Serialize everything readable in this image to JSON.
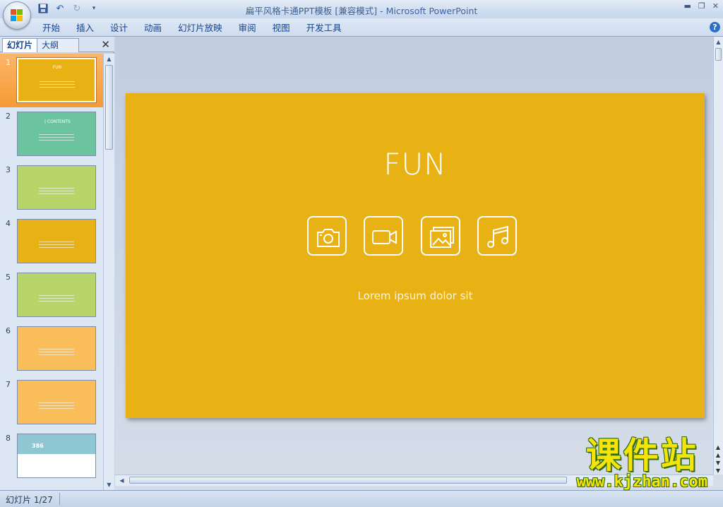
{
  "window": {
    "title_doc": "扁平风格卡通PPT模板 [兼容模式]",
    "title_sep": " - ",
    "title_app": "Microsoft PowerPoint"
  },
  "ribbon": {
    "tabs": [
      "开始",
      "插入",
      "设计",
      "动画",
      "幻灯片放映",
      "审阅",
      "视图",
      "开发工具"
    ],
    "help_label": "?"
  },
  "left_pane": {
    "tabs": [
      "幻灯片",
      "大纲"
    ],
    "close_label": "✕",
    "thumbnails": [
      {
        "num": "1",
        "bg": "#e8b215",
        "title": "FUN",
        "selected": true
      },
      {
        "num": "2",
        "bg": "#6cc3a0",
        "title": "| CONTENTS"
      },
      {
        "num": "3",
        "bg": "#b8d56a"
      },
      {
        "num": "4",
        "bg": "#e8b215"
      },
      {
        "num": "5",
        "bg": "#b8d56a"
      },
      {
        "num": "6",
        "bg": "#f9bd59"
      },
      {
        "num": "7",
        "bg": "#f9bd59"
      },
      {
        "num": "8",
        "bg": "#ffffff",
        "title": "386"
      }
    ]
  },
  "slide": {
    "title": "FUN",
    "subtitle": "Lorem ipsum dolor sit",
    "icons": [
      "camera-icon",
      "video-camera-icon",
      "image-icon",
      "music-note-icon"
    ],
    "bg_color": "#e8b215"
  },
  "status": {
    "slide_counter": "幻灯片 1/27"
  },
  "watermark": {
    "cn": "课件站",
    "url": "www.kjzhan.com"
  }
}
